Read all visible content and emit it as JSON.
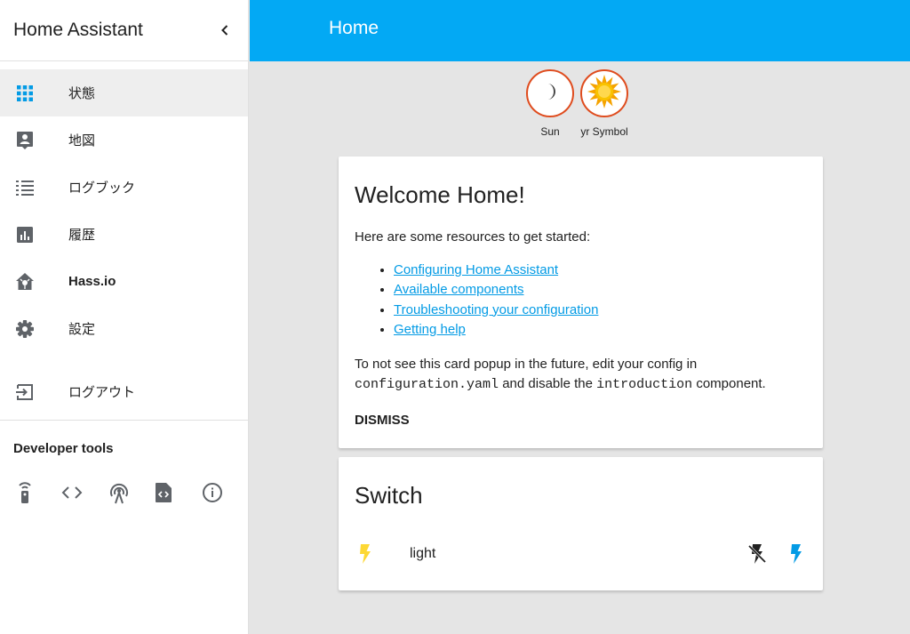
{
  "sidebar": {
    "title": "Home Assistant",
    "collapse_icon": "chevron-left-icon",
    "items": [
      {
        "label": "状態",
        "icon": "grid-icon",
        "active": true
      },
      {
        "label": "地図",
        "icon": "account-box-icon"
      },
      {
        "label": "ログブック",
        "icon": "list-icon"
      },
      {
        "label": "履歴",
        "icon": "chart-icon"
      },
      {
        "label": "Hass.io",
        "icon": "hassio-icon"
      },
      {
        "label": "設定",
        "icon": "gear-icon"
      }
    ],
    "logout": {
      "label": "ログアウト",
      "icon": "exit-icon"
    },
    "dev_tools_title": "Developer tools",
    "dev_tools": [
      "remote-icon",
      "code-icon",
      "antenna-icon",
      "file-code-icon",
      "info-icon"
    ]
  },
  "header": {
    "title": "Home"
  },
  "badges": [
    {
      "label": "Sun",
      "icon": "moon-icon"
    },
    {
      "label": "yr Symbol",
      "icon": "sun-icon"
    }
  ],
  "intro_card": {
    "title": "Welcome Home!",
    "lead": "Here are some resources to get started:",
    "links": [
      "Configuring Home Assistant",
      "Available components",
      "Troubleshooting your configuration",
      "Getting help"
    ],
    "note_part1": "To not see this card popup in the future, edit your config in",
    "note_code1": "configuration.yaml",
    "note_part2": " and disable the ",
    "note_code2": "introduction",
    "note_part3": " component.",
    "dismiss_label": "DISMISS"
  },
  "switch_card": {
    "title": "Switch",
    "entity_name": "light",
    "entity_icon": "flash-icon"
  },
  "colors": {
    "accent": "#03a9f4",
    "link": "#039be5",
    "badge_border": "#df4c1e",
    "flash_on": "#fdd835"
  }
}
